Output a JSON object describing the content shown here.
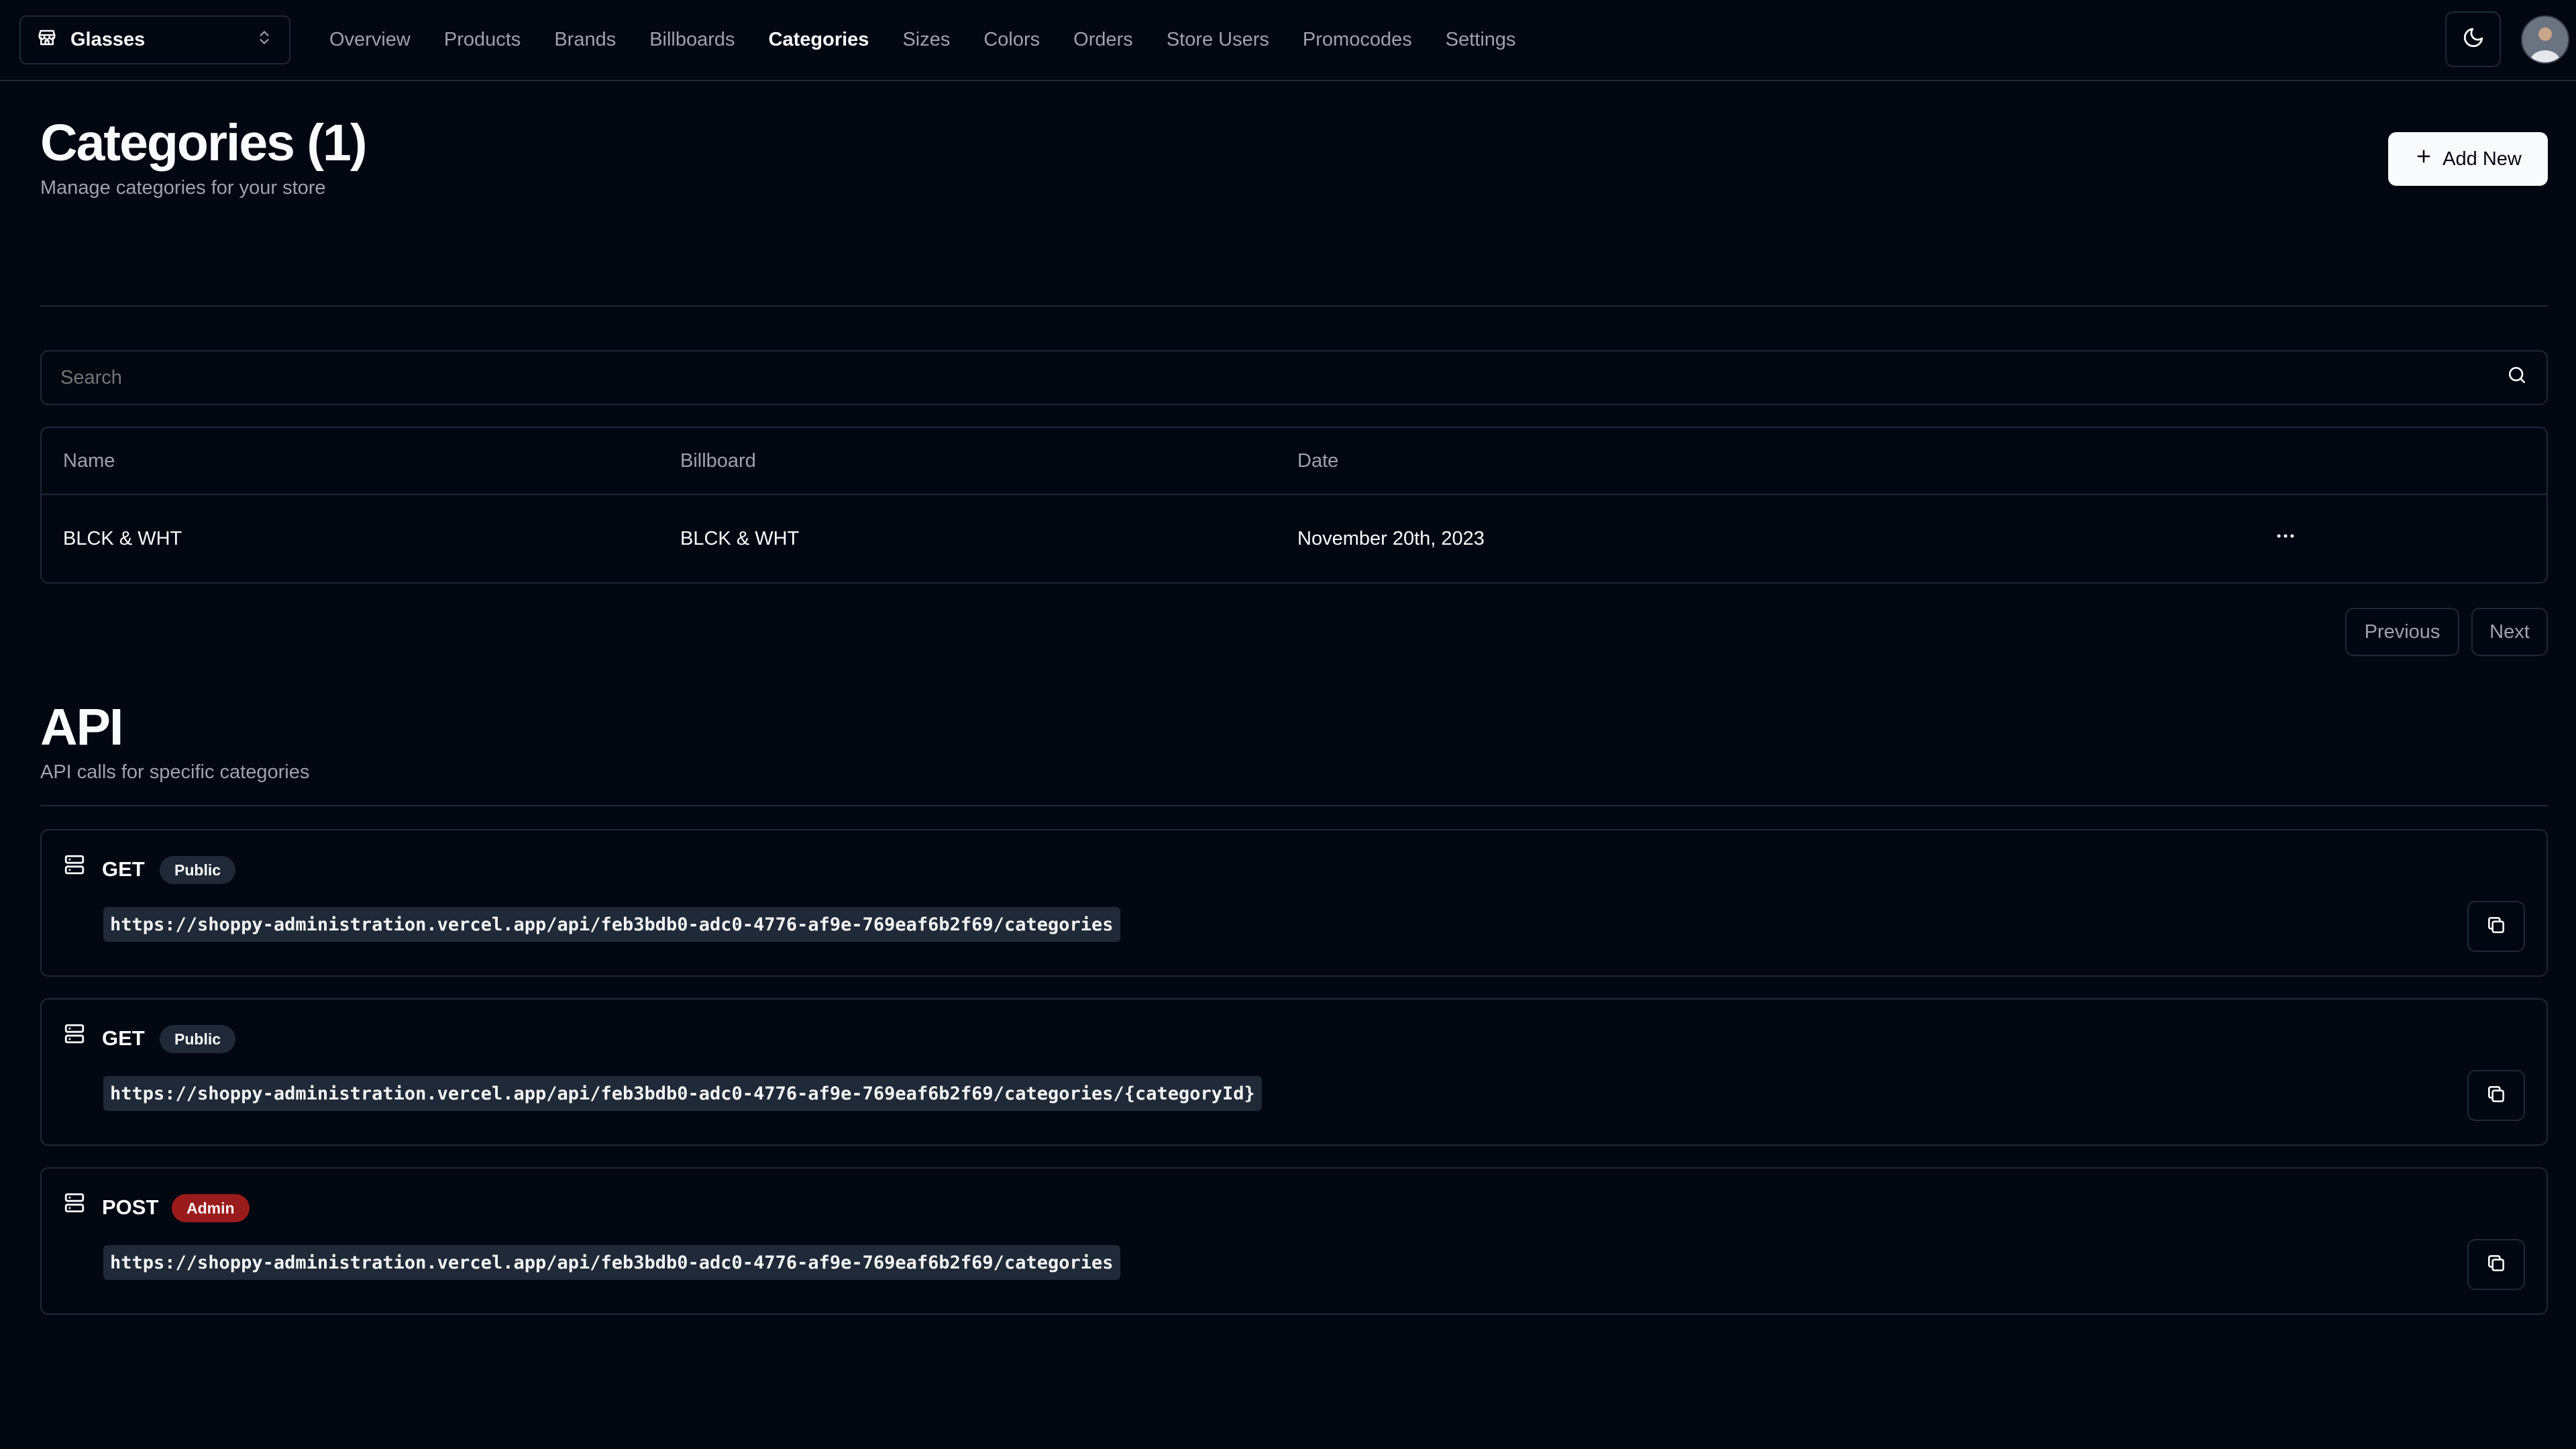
{
  "store": {
    "name": "Glasses"
  },
  "nav": {
    "items": [
      "Overview",
      "Products",
      "Brands",
      "Billboards",
      "Categories",
      "Sizes",
      "Colors",
      "Orders",
      "Store Users",
      "Promocodes",
      "Settings"
    ],
    "active": "Categories"
  },
  "categories_section": {
    "title": "Categories (1)",
    "subtitle": "Manage categories for your store",
    "add_label": "Add New"
  },
  "search": {
    "placeholder": "Search"
  },
  "table": {
    "columns": [
      "Name",
      "Billboard",
      "Date"
    ],
    "rows": [
      {
        "name": "BLCK & WHT",
        "billboard": "BLCK & WHT",
        "date": "November 20th, 2023"
      }
    ]
  },
  "pagination": {
    "previous_label": "Previous",
    "next_label": "Next"
  },
  "api_section": {
    "title": "API",
    "subtitle": "API calls for specific categories",
    "endpoints": [
      {
        "method": "GET",
        "access": "Public",
        "url": "https://shoppy-administration.vercel.app/api/feb3bdb0-adc0-4776-af9e-769eaf6b2f69/categories"
      },
      {
        "method": "GET",
        "access": "Public",
        "url": "https://shoppy-administration.vercel.app/api/feb3bdb0-adc0-4776-af9e-769eaf6b2f69/categories/{categoryId}"
      },
      {
        "method": "POST",
        "access": "Admin",
        "url": "https://shoppy-administration.vercel.app/api/feb3bdb0-adc0-4776-af9e-769eaf6b2f69/categories"
      }
    ]
  },
  "icons": {
    "store": "store-icon",
    "switcher": "chevrons-up-down-icon",
    "theme": "moon-icon",
    "add": "plus-icon",
    "search": "search-icon",
    "more": "more-horizontal-icon",
    "server": "server-icon",
    "copy": "copy-icon"
  },
  "colors": {
    "background": "#030712",
    "border": "#1f2937",
    "muted_text": "#9ca3af",
    "public_badge": "#1f2937",
    "admin_badge": "#991b1b"
  }
}
